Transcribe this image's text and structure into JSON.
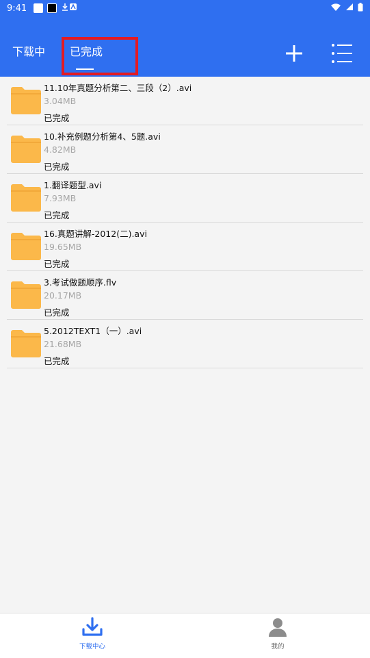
{
  "status": {
    "time": "9:41"
  },
  "tabs": [
    {
      "label": "下载中"
    },
    {
      "label": "已完成"
    }
  ],
  "items": [
    {
      "name": "11.10年真题分析第二、三段（2）.avi",
      "size": "3.04MB",
      "state": "已完成"
    },
    {
      "name": "10.补充例题分析第4、5题.avi",
      "size": "4.82MB",
      "state": "已完成"
    },
    {
      "name": "1.翻译题型.avi",
      "size": "7.93MB",
      "state": "已完成"
    },
    {
      "name": "16.真题讲解-2012(二).avi",
      "size": "19.65MB",
      "state": "已完成"
    },
    {
      "name": "3.考试做题顺序.flv",
      "size": "20.17MB",
      "state": "已完成"
    },
    {
      "name": "5.2012TEXT1（一）.avi",
      "size": "21.68MB",
      "state": "已完成"
    }
  ],
  "bottom_nav": [
    {
      "label": "下载中心"
    },
    {
      "label": "我的"
    }
  ],
  "colors": {
    "primary": "#2f6ff0",
    "folder": "#fbb84a",
    "highlight": "#e31b23"
  },
  "icons": {
    "add": "plus-icon",
    "menu": "list-menu-icon",
    "folder": "folder-icon",
    "download": "download-icon",
    "profile": "user-icon"
  }
}
